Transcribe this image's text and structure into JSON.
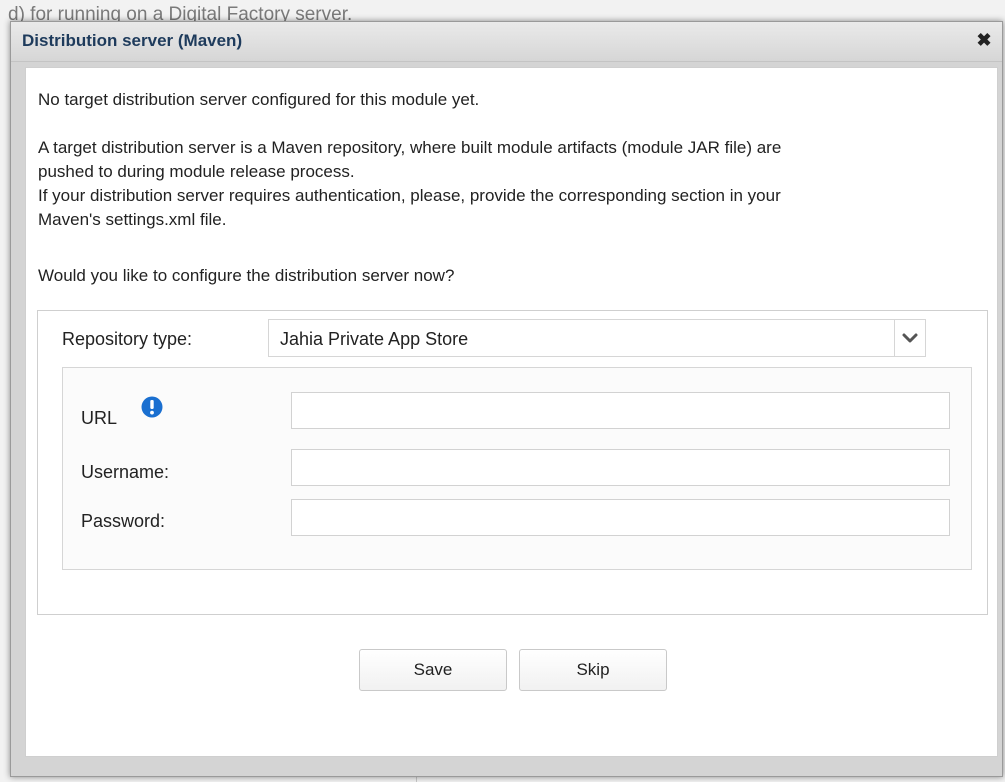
{
  "background": {
    "partial_text": "d) for running on a Digital Factory server."
  },
  "dialog": {
    "title": "Distribution server (Maven)",
    "close_symbol": "✖",
    "close_icon": "close-icon",
    "message_no_target": "No target distribution server configured for this module yet.",
    "description_line1": "A target distribution server is a Maven repository, where built module artifacts (module JAR file) are",
    "description_line2": "pushed to during module release process.",
    "description_line3": "If your distribution server requires authentication, please, provide the corresponding section in your",
    "description_line4": "Maven's settings.xml file.",
    "question": "Would you like to configure the distribution server now?",
    "form": {
      "repository_type_label": "Repository type:",
      "repository_type_value": "Jahia Private App Store",
      "dropdown_icon": "chevron-down-icon",
      "url_label": "URL",
      "url_info_icon": "info-icon",
      "url_value": "",
      "username_label": "Username:",
      "username_value": "",
      "password_label": "Password:",
      "password_value": ""
    },
    "buttons": {
      "save_label": "Save",
      "skip_label": "Skip"
    }
  },
  "colors": {
    "title_text": "#1e3b5c",
    "info_icon": "#1a6fd0"
  }
}
